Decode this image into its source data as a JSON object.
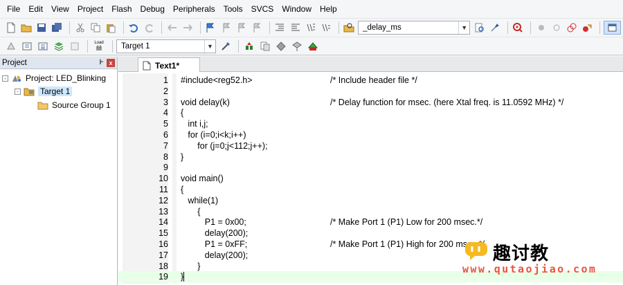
{
  "menu": [
    "File",
    "Edit",
    "View",
    "Project",
    "Flash",
    "Debug",
    "Peripherals",
    "Tools",
    "SVCS",
    "Window",
    "Help"
  ],
  "toolbar1": {
    "find_combo_value": "_delay_ms"
  },
  "toolbar2": {
    "target_combo_value": "Target 1",
    "load_label": "Load"
  },
  "project_panel": {
    "title": "Project",
    "pin_glyph": "Ͱ",
    "close_glyph": "x",
    "tree": [
      {
        "label": "Project: LED_Blinking",
        "expander": "-",
        "icon": "project-icon"
      },
      {
        "label": "Target 1",
        "expander": "-",
        "icon": "target-folder-icon"
      },
      {
        "label": "Source Group 1",
        "expander": "",
        "icon": "folder-icon"
      }
    ]
  },
  "editor": {
    "tab_label": "Text1*",
    "current_line": 19,
    "lines": [
      {
        "num": "1",
        "code": "#include<reg52.h>",
        "comment": "/* Include header file */"
      },
      {
        "num": "2",
        "code": "",
        "comment": ""
      },
      {
        "num": "3",
        "code": "void delay(k)",
        "comment": "/* Delay function for msec. (here Xtal freq. is 11.0592 MHz) */"
      },
      {
        "num": "4",
        "code": "{",
        "comment": ""
      },
      {
        "num": "5",
        "code": "   int i,j;",
        "comment": ""
      },
      {
        "num": "6",
        "code": "   for (i=0;i<k;i++)",
        "comment": ""
      },
      {
        "num": "7",
        "code": "       for (j=0;j<112;j++);",
        "comment": ""
      },
      {
        "num": "8",
        "code": "}",
        "comment": ""
      },
      {
        "num": "9",
        "code": "",
        "comment": ""
      },
      {
        "num": "10",
        "code": "void main()",
        "comment": ""
      },
      {
        "num": "11",
        "code": "{",
        "comment": ""
      },
      {
        "num": "12",
        "code": "   while(1)",
        "comment": ""
      },
      {
        "num": "13",
        "code": "       {",
        "comment": ""
      },
      {
        "num": "14",
        "code": "          P1 = 0x00;",
        "comment": "/* Make Port 1 (P1) Low for 200 msec.*/"
      },
      {
        "num": "15",
        "code": "          delay(200);",
        "comment": ""
      },
      {
        "num": "16",
        "code": "          P1 = 0xFF;",
        "comment": "/* Make Port 1 (P1) High for 200 msec.*/"
      },
      {
        "num": "17",
        "code": "          delay(200);",
        "comment": ""
      },
      {
        "num": "18",
        "code": "       }",
        "comment": ""
      },
      {
        "num": "19",
        "code": "}",
        "comment": ""
      }
    ]
  },
  "watermark": {
    "title": "趣讨教",
    "url": "www.qutaojiao.com"
  },
  "colors": {
    "accent_red": "#e8543f",
    "current_line": "#e8ffe8",
    "selection": "#cde8ff"
  }
}
